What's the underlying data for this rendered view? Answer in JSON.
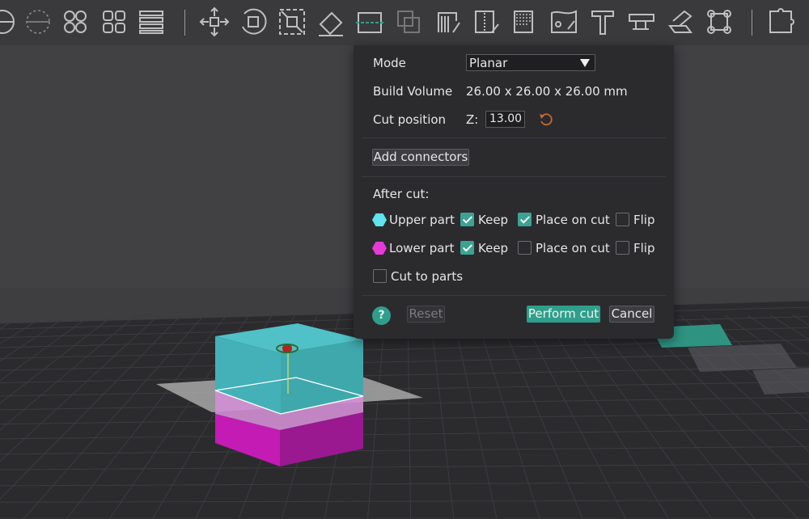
{
  "toolbar": {
    "tools": [
      {
        "name": "arrange-icon"
      },
      {
        "name": "orient-icon"
      },
      {
        "name": "split-objects-icon"
      },
      {
        "name": "split-parts-icon"
      },
      {
        "name": "layers-icon"
      },
      {
        "name": "move-icon"
      },
      {
        "name": "rotate-icon"
      },
      {
        "name": "scale-icon"
      },
      {
        "name": "lay-on-face-icon"
      },
      {
        "name": "cut-icon"
      },
      {
        "name": "mesh-boolean-icon"
      },
      {
        "name": "support-paint-icon"
      },
      {
        "name": "seam-paint-icon"
      },
      {
        "name": "fuzzy-skin-icon"
      },
      {
        "name": "color-paint-icon"
      },
      {
        "name": "text-icon"
      },
      {
        "name": "measure-icon"
      },
      {
        "name": "assembly-icon"
      },
      {
        "name": "brim-ears-icon"
      },
      {
        "name": "puzzle-icon"
      }
    ]
  },
  "cut_panel": {
    "mode_label": "Mode",
    "mode_value": "Planar",
    "build_volume_label": "Build Volume",
    "build_volume_value": "26.00 x 26.00 x 26.00 mm",
    "cut_position_label": "Cut position",
    "axis_label": "Z:",
    "cut_position_value": "13.00",
    "add_connectors_label": "Add connectors",
    "after_cut_label": "After cut:",
    "upper_part": {
      "label": "Upper part",
      "color": "#5fe3ec",
      "keep_label": "Keep",
      "keep": true,
      "place_label": "Place on cut",
      "place_on_cut": true,
      "flip_label": "Flip",
      "flip": false
    },
    "lower_part": {
      "label": "Lower part",
      "color": "#e63ad6",
      "keep_label": "Keep",
      "keep": true,
      "place_label": "Place on cut",
      "place_on_cut": false,
      "flip_label": "Flip",
      "flip": false
    },
    "cut_to_parts_label": "Cut to parts",
    "cut_to_parts": false,
    "help_label": "?",
    "reset_label": "Reset",
    "perform_label": "Perform cut",
    "cancel_label": "Cancel"
  },
  "colors": {
    "accent": "#2f9f8b",
    "upper_part": "#5fe3ec",
    "lower_part": "#e63ad6",
    "panel_bg": "#2b2b2e"
  }
}
